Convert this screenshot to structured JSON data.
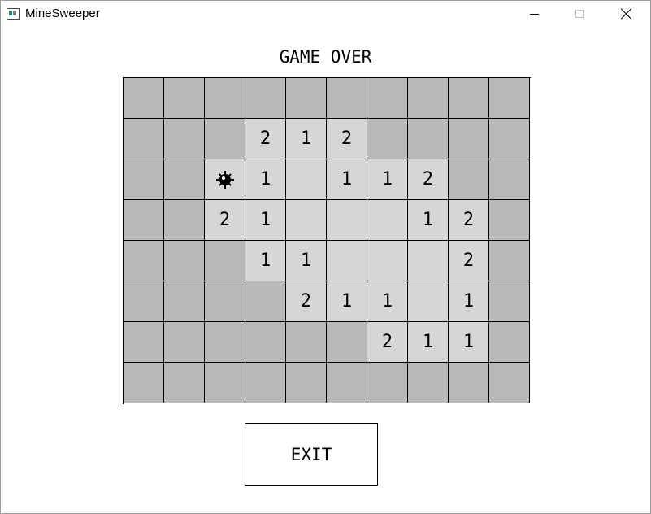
{
  "window": {
    "title": "MineSweeper",
    "icon": "minesweeper-app-icon",
    "controls": [
      "minimize-icon",
      "maximize-icon",
      "close-icon"
    ]
  },
  "game": {
    "status": "GAME OVER",
    "exit_label": "EXIT",
    "rows": 8,
    "cols": 10,
    "cell_colors": {
      "hidden": "#b9b9b9",
      "revealed": "#d6d6d6"
    },
    "grid": [
      [
        "#",
        "#",
        "#",
        "#",
        "#",
        "#",
        "#",
        "#",
        "#",
        "#"
      ],
      [
        "#",
        "#",
        "#",
        "2",
        "1",
        "2",
        "#",
        "#",
        "#",
        "#"
      ],
      [
        "#",
        "#",
        "*",
        "1",
        ".",
        "1",
        "1",
        "2",
        "#",
        "#"
      ],
      [
        "#",
        "#",
        "2",
        "1",
        ".",
        ".",
        ".",
        "1",
        "2",
        "#"
      ],
      [
        "#",
        "#",
        "#",
        "1",
        "1",
        ".",
        ".",
        ".",
        "2",
        "#"
      ],
      [
        "#",
        "#",
        "#",
        "#",
        "2",
        "1",
        "1",
        ".",
        "1",
        "#"
      ],
      [
        "#",
        "#",
        "#",
        "#",
        "#",
        "#",
        "2",
        "1",
        "1",
        "#"
      ],
      [
        "#",
        "#",
        "#",
        "#",
        "#",
        "#",
        "#",
        "#",
        "#",
        "#"
      ]
    ],
    "legend": {
      "#": "hidden",
      ".": "revealed-empty",
      "*": "mine-icon"
    }
  }
}
